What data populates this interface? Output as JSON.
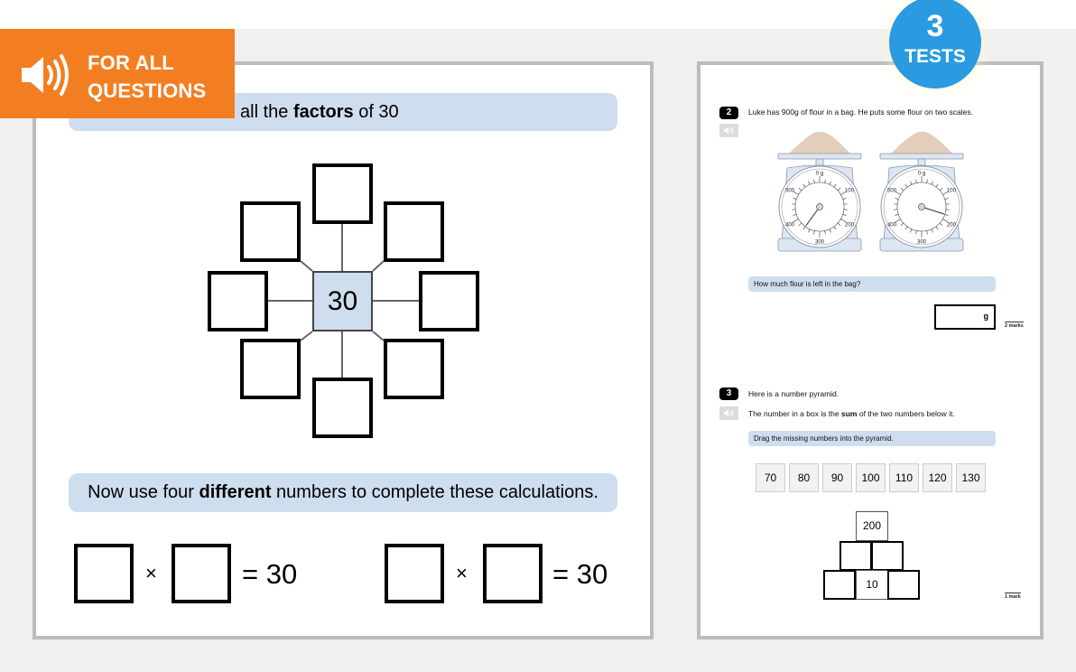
{
  "audio_banner": {
    "line1": "FOR ALL",
    "line2": "QUESTIONS",
    "icon": "speaker-icon"
  },
  "tests_badge": {
    "count": "3",
    "label": "TESTS"
  },
  "left_question": {
    "instruction_prefix": "all the ",
    "instruction_bold": "factors",
    "instruction_suffix": " of 30",
    "center_value": "30",
    "factor_boxes": [
      "",
      "",
      "",
      "",
      "",
      "",
      "",
      ""
    ],
    "calc_instruction_prefix": "Now use four ",
    "calc_instruction_bold": "different",
    "calc_instruction_suffix": " numbers to complete these calculations.",
    "calculations": [
      {
        "op": "×",
        "result": "= 30"
      },
      {
        "op": "×",
        "result": "= 30"
      }
    ]
  },
  "right_page": {
    "q2": {
      "number": "2",
      "text": "Luke has 900g of flour in a bag. He puts some flour on two scales.",
      "scales": [
        {
          "labels": [
            "0 g",
            "100",
            "200",
            "300",
            "400",
            "500"
          ],
          "reading_g": 360
        },
        {
          "labels": [
            "0 g",
            "100",
            "200",
            "300",
            "400",
            "500"
          ],
          "reading_g": 180
        }
      ],
      "instruction": "How much flour is left in the bag?",
      "answer_unit": "g",
      "marks": "2 marks"
    },
    "q3": {
      "number": "3",
      "line1": "Here is a number pyramid.",
      "line2_prefix": "The number in a box is the ",
      "line2_bold": "sum",
      "line2_suffix": " of the two numbers below it.",
      "instruction": "Drag the missing numbers into the pyramid.",
      "tiles": [
        "70",
        "80",
        "90",
        "100",
        "110",
        "120",
        "130"
      ],
      "pyramid": {
        "top": "200",
        "middle": [
          "",
          ""
        ],
        "bottom": [
          "",
          "10",
          ""
        ]
      },
      "marks": "1 mark"
    }
  },
  "colors": {
    "orange": "#f37e22",
    "blue_badge": "#2a9be0",
    "instruction_bg": "#cfdeee",
    "stage_bg": "#f0f0f0",
    "panel_border": "#bcbcbc"
  }
}
